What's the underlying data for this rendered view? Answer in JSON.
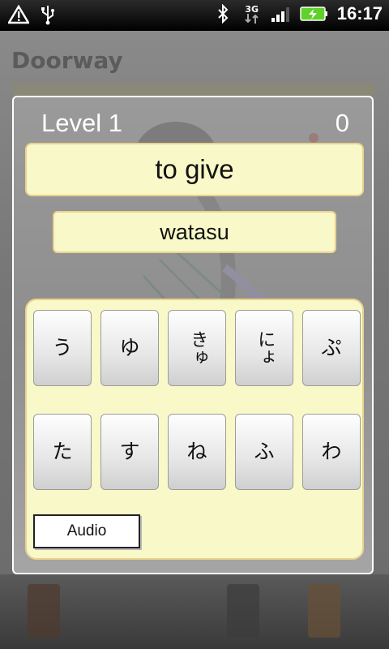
{
  "status_bar": {
    "time": "16:17",
    "left_icons": [
      "warning-icon",
      "usb-icon"
    ],
    "right_icons": [
      "bluetooth-icon",
      "network-3g-icon",
      "signal-icon",
      "battery-charging-icon"
    ],
    "network_label": "3G"
  },
  "background_app": {
    "title": "Doorway"
  },
  "dialog": {
    "level": "Level 1",
    "score": "0",
    "word": "to give",
    "romaji": "watasu",
    "keys_row1": [
      "う",
      "ゆ",
      "きゅ",
      "にょ",
      "ぷ"
    ],
    "keys_row2": [
      "た",
      "す",
      "ね",
      "ふ",
      "わ"
    ],
    "audio_label": "Audio"
  },
  "colors": {
    "panel_yellow": "#f8f8c8",
    "panel_border": "#e9d28e",
    "battery_green": "#5fd12a"
  }
}
